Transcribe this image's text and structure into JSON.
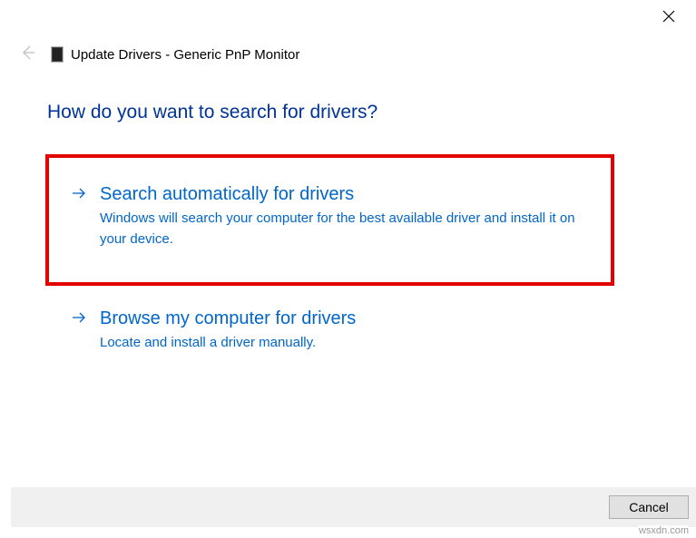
{
  "header": {
    "breadcrumb": "Update Drivers - Generic PnP Monitor"
  },
  "heading": "How do you want to search for drivers?",
  "options": [
    {
      "title": "Search automatically for drivers",
      "desc": "Windows will search your computer for the best available driver and install it on your device."
    },
    {
      "title": "Browse my computer for drivers",
      "desc": "Locate and install a driver manually."
    }
  ],
  "footer": {
    "cancel": "Cancel"
  },
  "watermark": "wsxdn.com"
}
